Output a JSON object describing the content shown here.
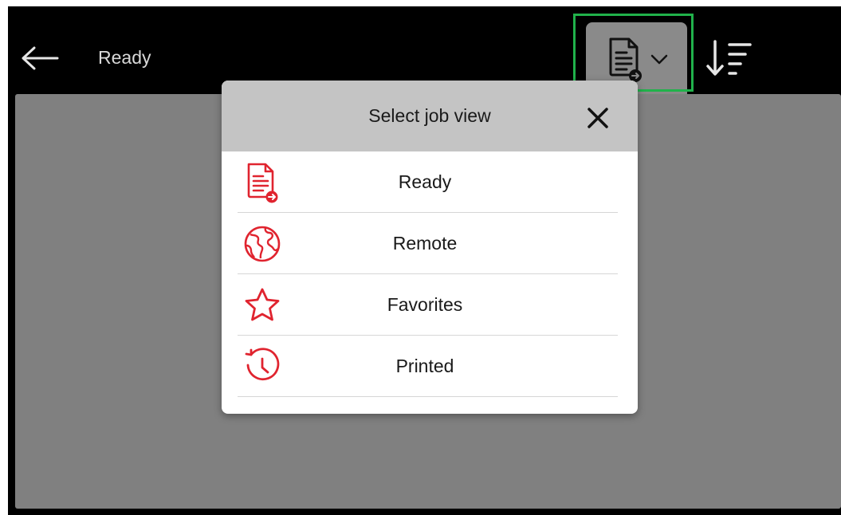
{
  "topbar": {
    "title": "Ready"
  },
  "modal": {
    "title": "Select job view",
    "items": [
      {
        "label": "Ready",
        "icon": "ready-document-icon"
      },
      {
        "label": "Remote",
        "icon": "globe-icon"
      },
      {
        "label": "Favorites",
        "icon": "star-icon"
      },
      {
        "label": "Printed",
        "icon": "history-clock-icon"
      }
    ]
  },
  "colors": {
    "accent": "#e0242f",
    "highlight": "#21b24b",
    "topbar": "#000000",
    "overlay": "#808080",
    "modal_header": "#c4c4c4"
  }
}
